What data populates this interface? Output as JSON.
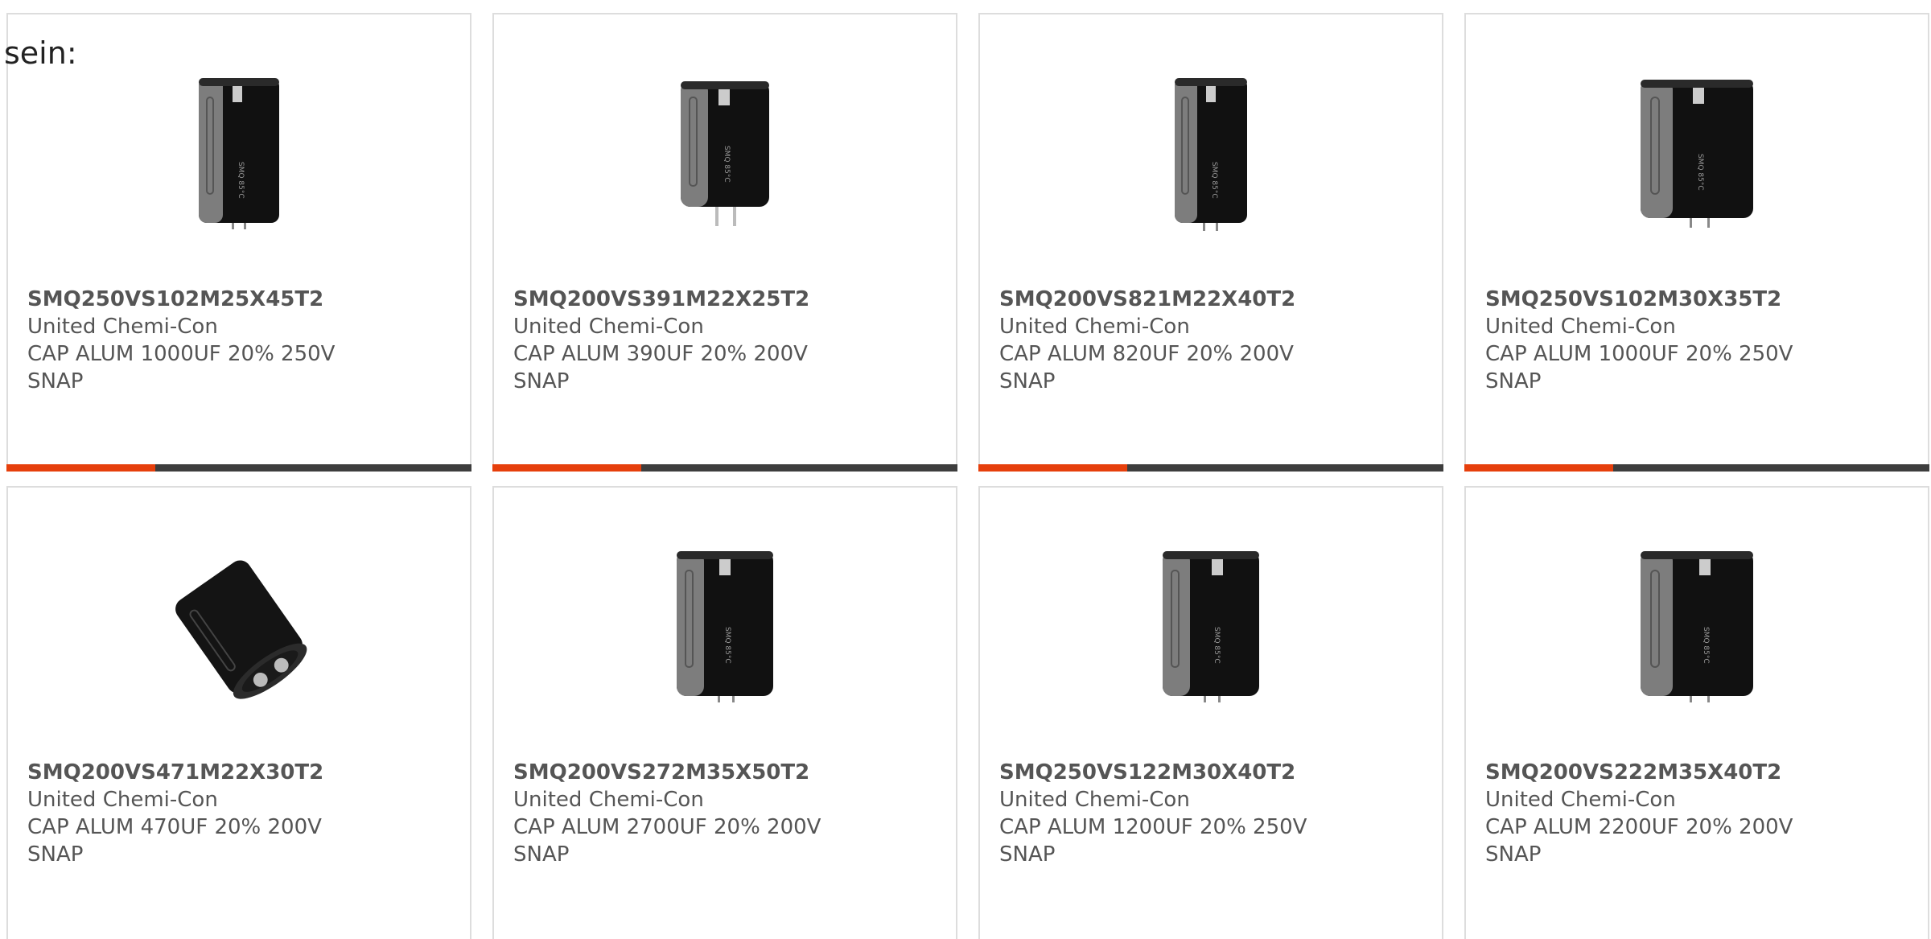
{
  "intro_text": "sein:",
  "colors": {
    "accent": "#e63f0c",
    "bar_track": "#3d3d3d",
    "card_border": "#dddddd",
    "text": "#555555"
  },
  "products": [
    {
      "part_number": "SMQ250VS102M25X45T2",
      "manufacturer": "United Chemi-Con",
      "description": "CAP ALUM 1000UF 20% 250V",
      "mount": "SNAP",
      "image": "capacitor-upright-icon",
      "progress": 0.32
    },
    {
      "part_number": "SMQ200VS391M22X25T2",
      "manufacturer": "United Chemi-Con",
      "description": "CAP ALUM 390UF 20% 200V",
      "mount": "SNAP",
      "image": "capacitor-upright-icon",
      "progress": 0.32
    },
    {
      "part_number": "SMQ200VS821M22X40T2",
      "manufacturer": "United Chemi-Con",
      "description": "CAP ALUM 820UF 20% 200V",
      "mount": "SNAP",
      "image": "capacitor-upright-icon",
      "progress": 0.32
    },
    {
      "part_number": "SMQ250VS102M30X35T2",
      "manufacturer": "United Chemi-Con",
      "description": "CAP ALUM 1000UF 20% 250V",
      "mount": "SNAP",
      "image": "capacitor-upright-icon",
      "progress": 0.32
    },
    {
      "part_number": "SMQ200VS471M22X30T2",
      "manufacturer": "United Chemi-Con",
      "description": "CAP ALUM 470UF 20% 200V",
      "mount": "SNAP",
      "image": "capacitor-tilted-icon"
    },
    {
      "part_number": "SMQ200VS272M35X50T2",
      "manufacturer": "United Chemi-Con",
      "description": "CAP ALUM 2700UF 20% 200V",
      "mount": "SNAP",
      "image": "capacitor-upright-icon"
    },
    {
      "part_number": "SMQ250VS122M30X40T2",
      "manufacturer": "United Chemi-Con",
      "description": "CAP ALUM 1200UF 20% 250V",
      "mount": "SNAP",
      "image": "capacitor-upright-icon"
    },
    {
      "part_number": "SMQ200VS222M35X40T2",
      "manufacturer": "United Chemi-Con",
      "description": "CAP ALUM 2200UF 20% 200V",
      "mount": "SNAP",
      "image": "capacitor-upright-icon"
    }
  ]
}
